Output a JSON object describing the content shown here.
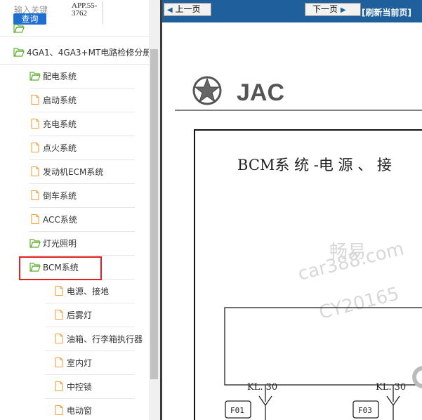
{
  "search": {
    "keyword_label": "输入关键",
    "query_button": "查询",
    "result_line1": "APP.55-",
    "result_line2": "3762"
  },
  "tree": {
    "root": "4GA1、4GA3+MT电路检修分册",
    "items": [
      {
        "label": "配电系统"
      },
      {
        "label": "启动系统"
      },
      {
        "label": "充电系统"
      },
      {
        "label": "点火系统"
      },
      {
        "label": "发动机ECM系统"
      },
      {
        "label": "倒车系统"
      },
      {
        "label": "ACC系统"
      },
      {
        "label": "灯光照明"
      },
      {
        "label": "BCM系统"
      },
      {
        "label": "电源、接地"
      },
      {
        "label": "后雾灯"
      },
      {
        "label": "油箱、行李箱执行器"
      },
      {
        "label": "室内灯"
      },
      {
        "label": "中控锁"
      },
      {
        "label": "电动窗"
      }
    ]
  },
  "toolbar": {
    "prev_label": "上一页",
    "next_label": "下一页",
    "refresh_label": "[刷新当前页]"
  },
  "document": {
    "brand": "JAC",
    "heading": "BCM系 统 -电 源 、 接",
    "watermark_cn": "畅易",
    "watermark_site": "car388.com",
    "watermark_code": "CY20165",
    "kl_left": "KL. 30",
    "kl_right": "KL. 30",
    "fuse_left": "F01",
    "fuse_right": "F03"
  },
  "colors": {
    "toolbar_bg": "#1f5f9c",
    "query_button_bg": "#1e6fd0",
    "selection_border": "#e02020",
    "folder_icon": "#5ab12d",
    "file_icon": "#f0a040"
  }
}
